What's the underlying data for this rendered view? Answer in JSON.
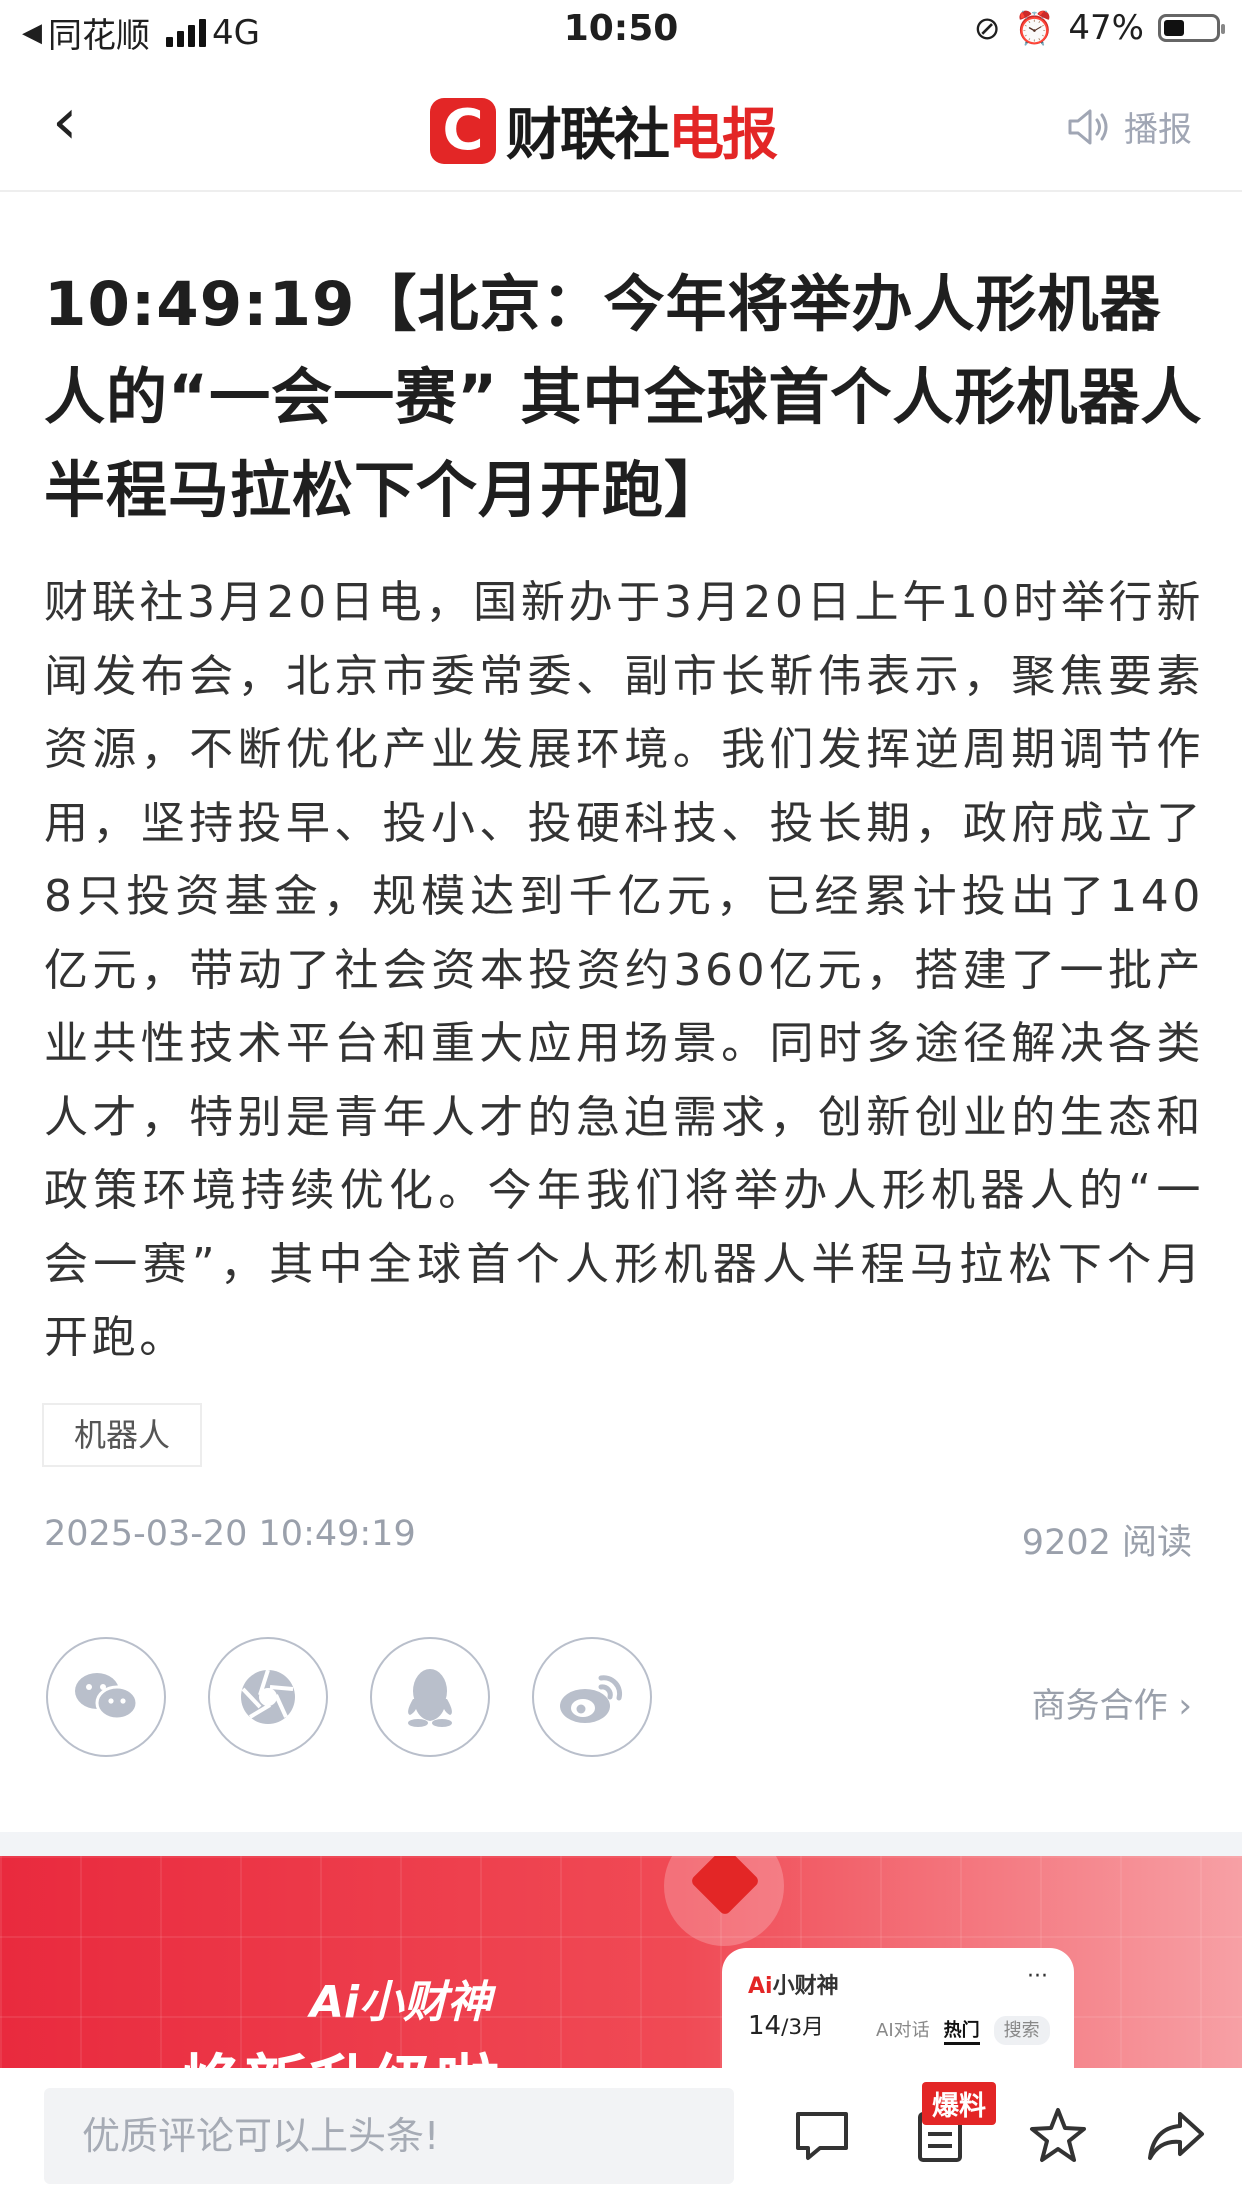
{
  "status_bar": {
    "carrier": "同花顺",
    "network": "4G",
    "time": "10:50",
    "battery": "47%"
  },
  "nav": {
    "logo_mark": "C",
    "logo_text": "财联社",
    "logo_text_red": "电报",
    "broadcast_label": "播报"
  },
  "article": {
    "headline": "10:49:19【北京：今年将举办人形机器人的“一会一赛” 其中全球首个人形机器人半程马拉松下个月开跑】",
    "body": "财联社3月20日电，国新办于3月20日上午10时举行新闻发布会，北京市委常委、副市长靳伟表示，聚焦要素资源，不断优化产业发展环境。我们发挥逆周期调节作用，坚持投早、投小、投硬科技、投长期，政府成立了8只投资基金，规模达到千亿元，已经累计投出了140亿元，带动了社会资本投资约360亿元，搭建了一批产业共性技术平台和重大应用场景。同时多途径解决各类人才，特别是青年人才的急迫需求，创新创业的生态和政策环境持续优化。今年我们将举办人形机器人的“一会一赛”，其中全球首个人形机器人半程马拉松下个月开跑。",
    "tag": "机器人",
    "datetime": "2025-03-20 10:49:19",
    "reads": "9202 阅读"
  },
  "share": {
    "icons": [
      "wechat-icon",
      "moments-icon",
      "qq-icon",
      "weibo-icon"
    ],
    "business_link": "商务合作 ›"
  },
  "banner": {
    "brand": "Ai小财神",
    "headline": "焕新升级啦",
    "phone_title_ai": "Ai",
    "phone_title": "小财神",
    "phone_menu": "···",
    "phone_date_day": "14",
    "phone_date_month": "/3月",
    "phone_tab_1": "AI对话",
    "phone_tab_2": "热门",
    "phone_search": "搜索"
  },
  "bottom_bar": {
    "comment_placeholder": "优质评论可以上头条!",
    "burst_badge": "爆料"
  },
  "colors": {
    "brand_red": "#e32626",
    "meta_gray": "#9aa0ab"
  }
}
